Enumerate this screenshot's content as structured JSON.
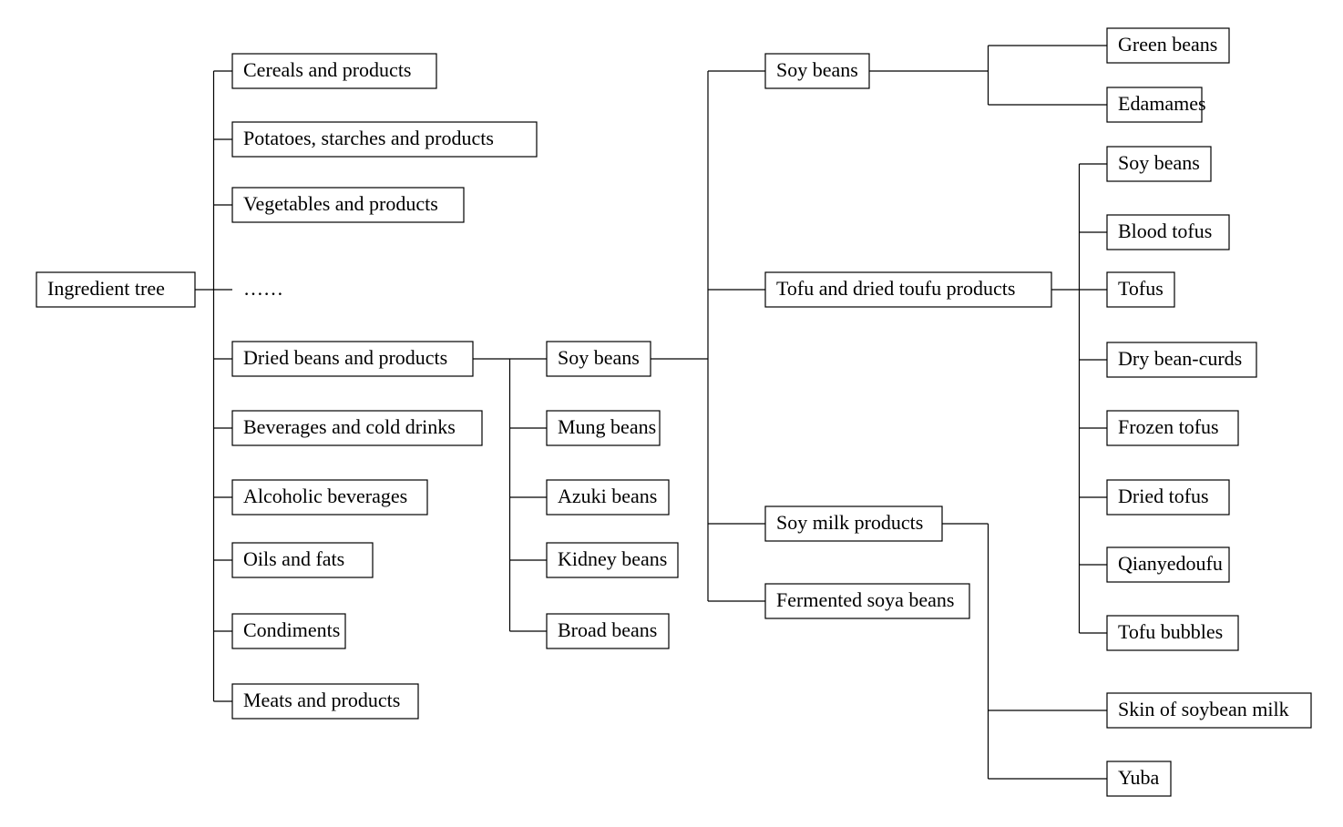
{
  "diagram": {
    "title": "Ingredient tree",
    "root": {
      "id": "root",
      "label": "Ingredient tree"
    },
    "level1": [
      {
        "id": "cereals",
        "label": "Cereals and products"
      },
      {
        "id": "potatoes",
        "label": "Potatoes, starches and products"
      },
      {
        "id": "vegetables",
        "label": "Vegetables and products"
      },
      {
        "id": "ellipsis",
        "label": "……"
      },
      {
        "id": "dried-beans",
        "label": "Dried beans and products"
      },
      {
        "id": "beverages",
        "label": "Beverages and cold drinks"
      },
      {
        "id": "alcoholic",
        "label": "Alcoholic beverages"
      },
      {
        "id": "oils",
        "label": "Oils and fats"
      },
      {
        "id": "condiments",
        "label": "Condiments"
      },
      {
        "id": "meats",
        "label": "Meats and products"
      }
    ],
    "level2": [
      {
        "id": "soy-beans-2",
        "label": "Soy beans"
      },
      {
        "id": "mung-beans",
        "label": "Mung beans"
      },
      {
        "id": "azuki-beans",
        "label": "Azuki beans"
      },
      {
        "id": "kidney-beans",
        "label": "Kidney beans"
      },
      {
        "id": "broad-beans",
        "label": "Broad beans"
      }
    ],
    "level3": [
      {
        "id": "soy-beans-3",
        "label": "Soy beans"
      },
      {
        "id": "tofu-dried-products",
        "label": "Tofu and dried toufu products"
      },
      {
        "id": "soy-milk-products",
        "label": "Soy milk products"
      },
      {
        "id": "fermented-soya-beans",
        "label": "Fermented soya beans"
      }
    ],
    "level4_soybeans": [
      {
        "id": "green-beans",
        "label": "Green beans"
      },
      {
        "id": "edamames",
        "label": "Edamames"
      }
    ],
    "level4_tofu": [
      {
        "id": "soy-beans-4",
        "label": "Soy beans"
      },
      {
        "id": "blood-tofus",
        "label": "Blood tofus"
      },
      {
        "id": "tofus",
        "label": "Tofus"
      },
      {
        "id": "dry-bean-curds",
        "label": "Dry bean-curds"
      },
      {
        "id": "frozen-tofus",
        "label": "Frozen tofus"
      },
      {
        "id": "dried-tofus",
        "label": "Dried tofus"
      },
      {
        "id": "qianyedoufu",
        "label": "Qianyedoufu"
      },
      {
        "id": "tofu-bubbles",
        "label": "Tofu bubbles"
      }
    ],
    "level4_soymilk": [
      {
        "id": "skin-soybean-milk",
        "label": "Skin of soybean milk"
      },
      {
        "id": "yuba",
        "label": "Yuba"
      }
    ]
  }
}
